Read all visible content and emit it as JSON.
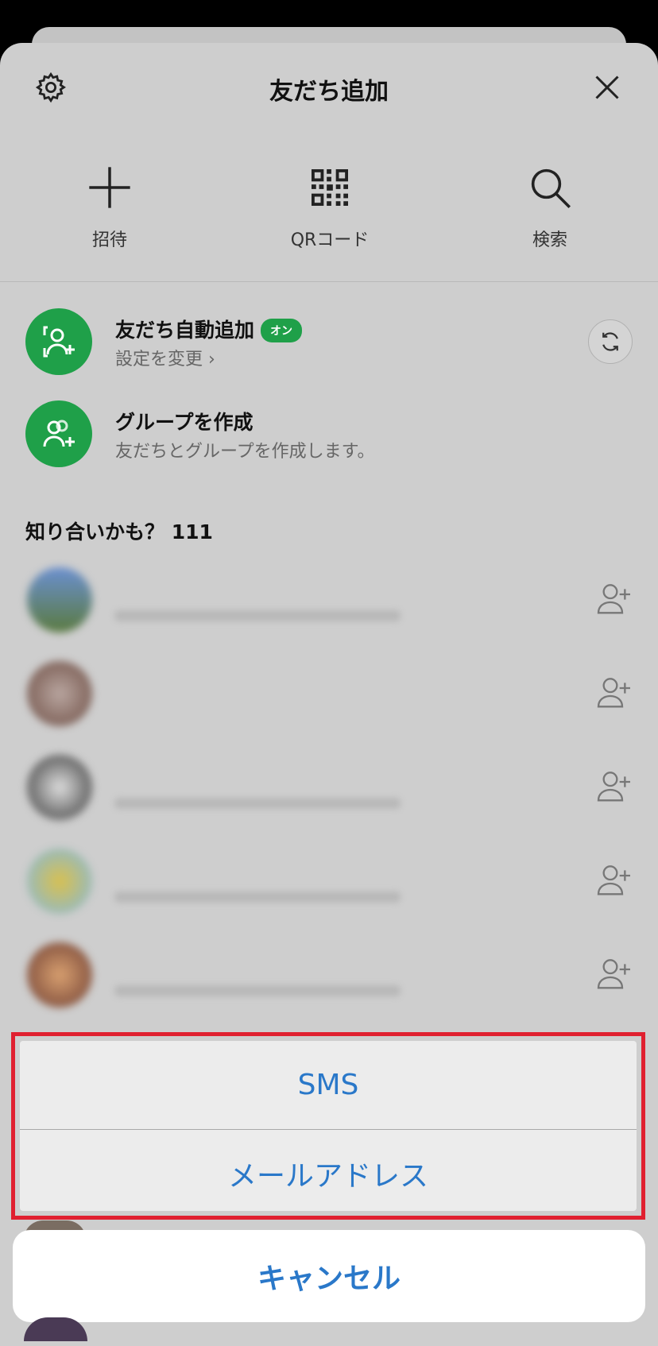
{
  "header": {
    "title": "友だち追加"
  },
  "actions": [
    {
      "label": "招待",
      "icon": "plus-icon"
    },
    {
      "label": "QRコード",
      "icon": "qr-code-icon"
    },
    {
      "label": "検索",
      "icon": "search-icon"
    }
  ],
  "auto_add": {
    "title": "友だち自動追加",
    "badge": "オン",
    "subtitle": "設定を変更 ›"
  },
  "create_group": {
    "title": "グループを作成",
    "subtitle": "友だちとグループを作成します。"
  },
  "suggestions": {
    "header": "知り合いかも？ 111"
  },
  "action_sheet": {
    "options": [
      "SMS",
      "メールアドレス"
    ],
    "cancel": "キャンセル"
  },
  "colors": {
    "accent_green": "#1fa049",
    "link_blue": "#2a78c9",
    "highlight_red": "#e02030"
  }
}
